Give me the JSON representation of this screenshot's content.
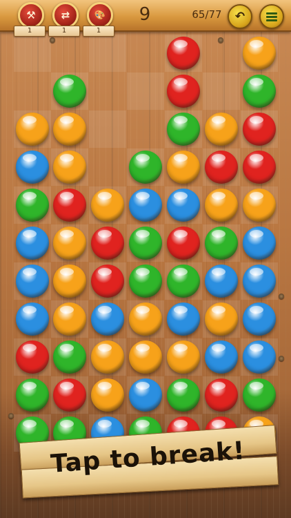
{
  "topbar": {
    "tools": [
      {
        "icon": "hammer-icon",
        "glyph": "⚒",
        "count": "1"
      },
      {
        "icon": "swap-icon",
        "glyph": "⇄",
        "count": "1"
      },
      {
        "icon": "palette-icon",
        "glyph": "🎨",
        "count": "1"
      }
    ],
    "score": "9",
    "progress": "65/77",
    "undo_glyph": "↶"
  },
  "colors": {
    "R": "#e0231f",
    "G": "#2fb52a",
    "B": "#2b8fe0",
    "O": "#f7a21a"
  },
  "grid": [
    [
      "",
      "",
      "",
      "",
      "R",
      "",
      "O"
    ],
    [
      "",
      "G",
      "",
      "",
      "R",
      "",
      "G"
    ],
    [
      "O",
      "O",
      "",
      "",
      "G",
      "O",
      "R"
    ],
    [
      "B",
      "O",
      "",
      "G",
      "O",
      "R",
      "R"
    ],
    [
      "G",
      "R",
      "O",
      "B",
      "B",
      "O",
      "O"
    ],
    [
      "B",
      "O",
      "R",
      "G",
      "R",
      "G",
      "B"
    ],
    [
      "B",
      "O",
      "R",
      "G",
      "G",
      "B",
      "B"
    ],
    [
      "B",
      "O",
      "B",
      "O",
      "B",
      "O",
      "B"
    ],
    [
      "R",
      "G",
      "O",
      "O",
      "O",
      "B",
      "B"
    ],
    [
      "G",
      "R",
      "O",
      "B",
      "G",
      "R",
      "G"
    ],
    [
      "G",
      "G",
      "B",
      "G",
      "R",
      "R",
      "O"
    ]
  ],
  "sign": {
    "text": "Tap to break!"
  }
}
